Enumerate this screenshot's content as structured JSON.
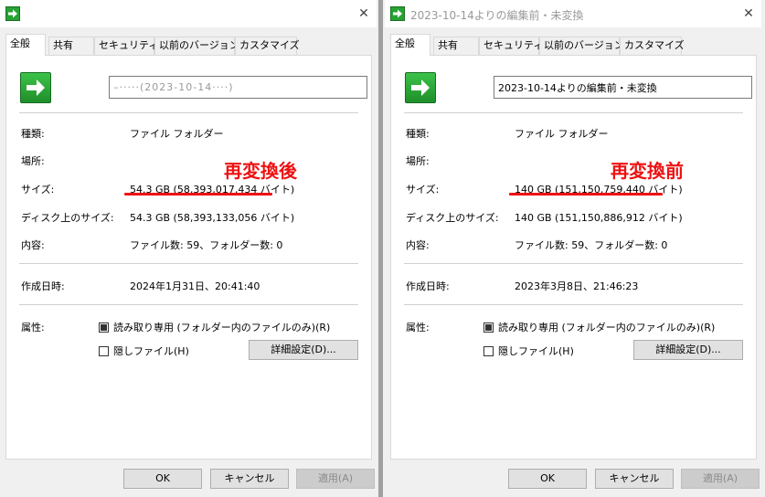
{
  "left": {
    "window_title": "",
    "close_symbol": "✕",
    "tabs": [
      {
        "label": "全般",
        "active": true
      },
      {
        "label": "共有",
        "active": false
      },
      {
        "label": "セキュリティ",
        "active": false
      },
      {
        "label": "以前のバージョン",
        "active": false
      },
      {
        "label": "カスタマイズ",
        "active": false
      }
    ],
    "name_value": "–·····(2023-10-14····)",
    "annotation": "再変換後",
    "rows": {
      "type_label": "種類:",
      "type_value": "ファイル フォルダー",
      "location_label": "場所:",
      "location_value": "",
      "size_label": "サイズ:",
      "size_value": "54.3 GB (58,393,017,434 バイト)",
      "disk_size_label": "ディスク上のサイズ:",
      "disk_size_value": "54.3 GB (58,393,133,056 バイト)",
      "contents_label": "内容:",
      "contents_value": "ファイル数: 59、フォルダー数: 0",
      "created_label": "作成日時:",
      "created_value": "2024年1月31日、20:41:40",
      "attributes_label": "属性:"
    },
    "readonly_label": "読み取り専用 (フォルダー内のファイルのみ)(R)",
    "readonly_state": "indeterminate",
    "hidden_label": "隠しファイル(H)",
    "hidden_checked": false,
    "detail_button": "詳細設定(D)...",
    "ok_button": "OK",
    "cancel_button": "キャンセル",
    "apply_button": "適用(A)"
  },
  "right": {
    "window_title": "2023-10-14よりの編集前・未変換",
    "close_symbol": "✕",
    "tabs": [
      {
        "label": "全般",
        "active": true
      },
      {
        "label": "共有",
        "active": false
      },
      {
        "label": "セキュリティ",
        "active": false
      },
      {
        "label": "以前のバージョン",
        "active": false
      },
      {
        "label": "カスタマイズ",
        "active": false
      }
    ],
    "name_value": "2023-10-14よりの編集前・未変換",
    "annotation": "再変換前",
    "rows": {
      "type_label": "種類:",
      "type_value": "ファイル フォルダー",
      "location_label": "場所:",
      "location_value": "",
      "size_label": "サイズ:",
      "size_value": "140 GB (151,150,759,440 バイト)",
      "disk_size_label": "ディスク上のサイズ:",
      "disk_size_value": "140 GB (151,150,886,912 バイト)",
      "contents_label": "内容:",
      "contents_value": "ファイル数: 59、フォルダー数: 0",
      "created_label": "作成日時:",
      "created_value": "2023年3月8日、21:46:23",
      "attributes_label": "属性:"
    },
    "readonly_label": "読み取り専用 (フォルダー内のファイルのみ)(R)",
    "readonly_state": "indeterminate",
    "hidden_label": "隠しファイル(H)",
    "hidden_checked": false,
    "detail_button": "詳細設定(D)...",
    "ok_button": "OK",
    "cancel_button": "キャンセル",
    "apply_button": "適用(A)"
  },
  "colors": {
    "annotation": "#ee1111",
    "icon_green": "#27a234",
    "window_bg": "#f0f0f0",
    "panel_bg": "#ffffff"
  },
  "icons": {
    "title_icon": "green-arrow-icon",
    "folder_icon": "green-arrow-folder-icon",
    "close_icon": "close-icon"
  }
}
